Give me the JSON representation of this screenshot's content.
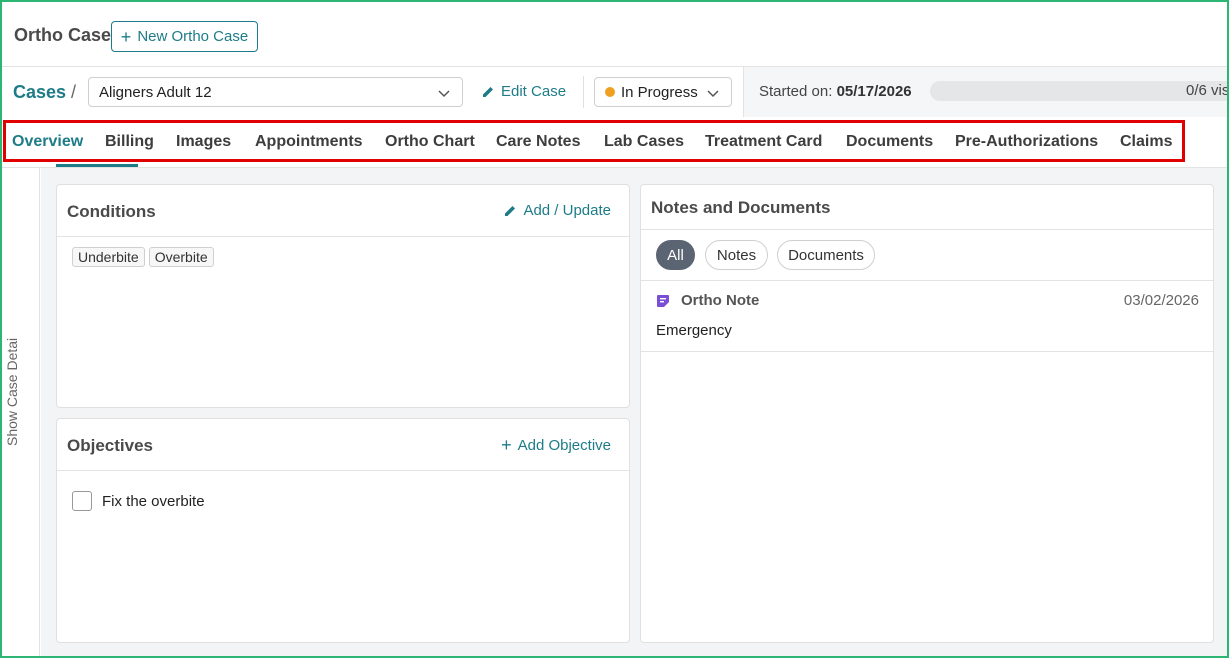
{
  "header": {
    "title": "Ortho Case",
    "new_case_label": "New Ortho Case"
  },
  "breadcrumb": {
    "cases_label": "Cases",
    "separator": "/",
    "selected_case": "Aligners Adult 12",
    "edit_case_label": "Edit Case",
    "status": "In Progress",
    "status_color": "#f0a020",
    "started_label": "Started on:",
    "started_date": "05/17/2026",
    "visits_text": "0/6 vis",
    "visits_progress": 0
  },
  "tabs": [
    {
      "label": "Overview",
      "active": true
    },
    {
      "label": "Billing"
    },
    {
      "label": "Images"
    },
    {
      "label": "Appointments"
    },
    {
      "label": "Ortho Chart"
    },
    {
      "label": "Care Notes"
    },
    {
      "label": "Lab Cases"
    },
    {
      "label": "Treatment Card"
    },
    {
      "label": "Documents"
    },
    {
      "label": "Pre-Authorizations"
    },
    {
      "label": "Claims"
    }
  ],
  "rail": {
    "label": "Show Case Detai"
  },
  "conditions": {
    "title": "Conditions",
    "action_label": "Add / Update",
    "items": [
      "Underbite",
      "Overbite"
    ]
  },
  "objectives": {
    "title": "Objectives",
    "action_label": "Add Objective",
    "items": [
      {
        "label": "Fix the overbite",
        "checked": false
      }
    ]
  },
  "notes": {
    "title": "Notes and Documents",
    "filters": [
      {
        "label": "All",
        "active": true
      },
      {
        "label": "Notes"
      },
      {
        "label": "Documents"
      }
    ],
    "entries": [
      {
        "type": "Ortho Note",
        "date": "03/02/2026",
        "text": "Emergency",
        "icon": "note-icon",
        "icon_color": "#7a4fd6"
      }
    ]
  },
  "colors": {
    "accent": "#1d7c87",
    "highlight_box": "#e00000",
    "frame": "#2bb673"
  }
}
